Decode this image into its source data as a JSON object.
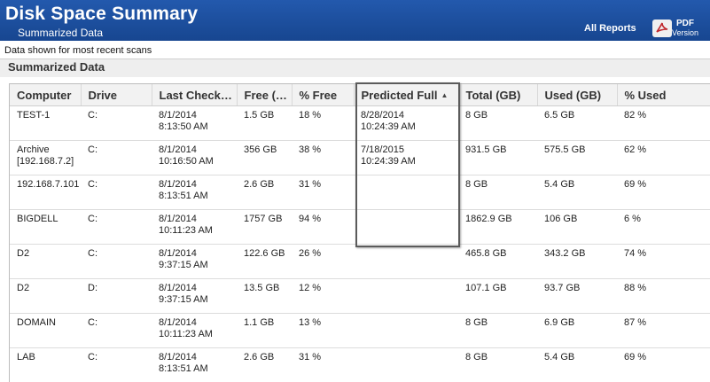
{
  "header": {
    "title": "Disk Space Summary",
    "subtitle": "Summarized Data",
    "all_reports": "All Reports",
    "pdf_label": "PDF",
    "pdf_sub": "Version"
  },
  "note": "Data shown for most recent scans",
  "section_title": "Summarized Data",
  "table": {
    "columns": [
      "Computer",
      "Drive",
      "Last Check…",
      "Free (…",
      "% Free",
      "Predicted Full",
      "Total (GB)",
      "Used (GB)",
      "% Used"
    ],
    "sorted_column": "Predicted Full",
    "rows": [
      {
        "computer": "TEST-1",
        "drive": "C:",
        "last_check": "8/1/2014\n8:13:50 AM",
        "free": "1.5 GB",
        "pct_free": "18 %",
        "predicted_full": "8/28/2014\n10:24:39 AM",
        "total": "8 GB",
        "used": "6.5 GB",
        "pct_used": "82 %"
      },
      {
        "computer": "Archive\n[192.168.7.2]",
        "drive": "C:",
        "last_check": "8/1/2014\n10:16:50 AM",
        "free": "356 GB",
        "pct_free": "38 %",
        "predicted_full": "7/18/2015\n10:24:39 AM",
        "total": "931.5 GB",
        "used": "575.5 GB",
        "pct_used": "62 %"
      },
      {
        "computer": "192.168.7.101",
        "drive": "C:",
        "last_check": "8/1/2014\n8:13:51 AM",
        "free": "2.6 GB",
        "pct_free": "31 %",
        "predicted_full": "",
        "total": "8 GB",
        "used": "5.4 GB",
        "pct_used": "69 %"
      },
      {
        "computer": "BIGDELL",
        "drive": "C:",
        "last_check": "8/1/2014\n10:11:23 AM",
        "free": "1757 GB",
        "pct_free": "94 %",
        "predicted_full": "",
        "total": "1862.9 GB",
        "used": "106 GB",
        "pct_used": "6 %"
      },
      {
        "computer": "D2",
        "drive": "C:",
        "last_check": "8/1/2014\n9:37:15 AM",
        "free": "122.6 GB",
        "pct_free": "26 %",
        "predicted_full": "",
        "total": "465.8 GB",
        "used": "343.2 GB",
        "pct_used": "74 %"
      },
      {
        "computer": "D2",
        "drive": "D:",
        "last_check": "8/1/2014\n9:37:15 AM",
        "free": "13.5 GB",
        "pct_free": "12 %",
        "predicted_full": "",
        "total": "107.1 GB",
        "used": "93.7 GB",
        "pct_used": "88 %"
      },
      {
        "computer": "DOMAIN",
        "drive": "C:",
        "last_check": "8/1/2014\n10:11:23 AM",
        "free": "1.1 GB",
        "pct_free": "13 %",
        "predicted_full": "",
        "total": "8 GB",
        "used": "6.9 GB",
        "pct_used": "87 %"
      },
      {
        "computer": "LAB",
        "drive": "C:",
        "last_check": "8/1/2014\n8:13:51 AM",
        "free": "2.6 GB",
        "pct_free": "31 %",
        "predicted_full": "",
        "total": "8 GB",
        "used": "5.4 GB",
        "pct_used": "69 %"
      }
    ]
  },
  "colors": {
    "header_bg": "#1d4f9e",
    "section_bg": "#eeeeee",
    "highlight_border": "#5b5b5b"
  }
}
